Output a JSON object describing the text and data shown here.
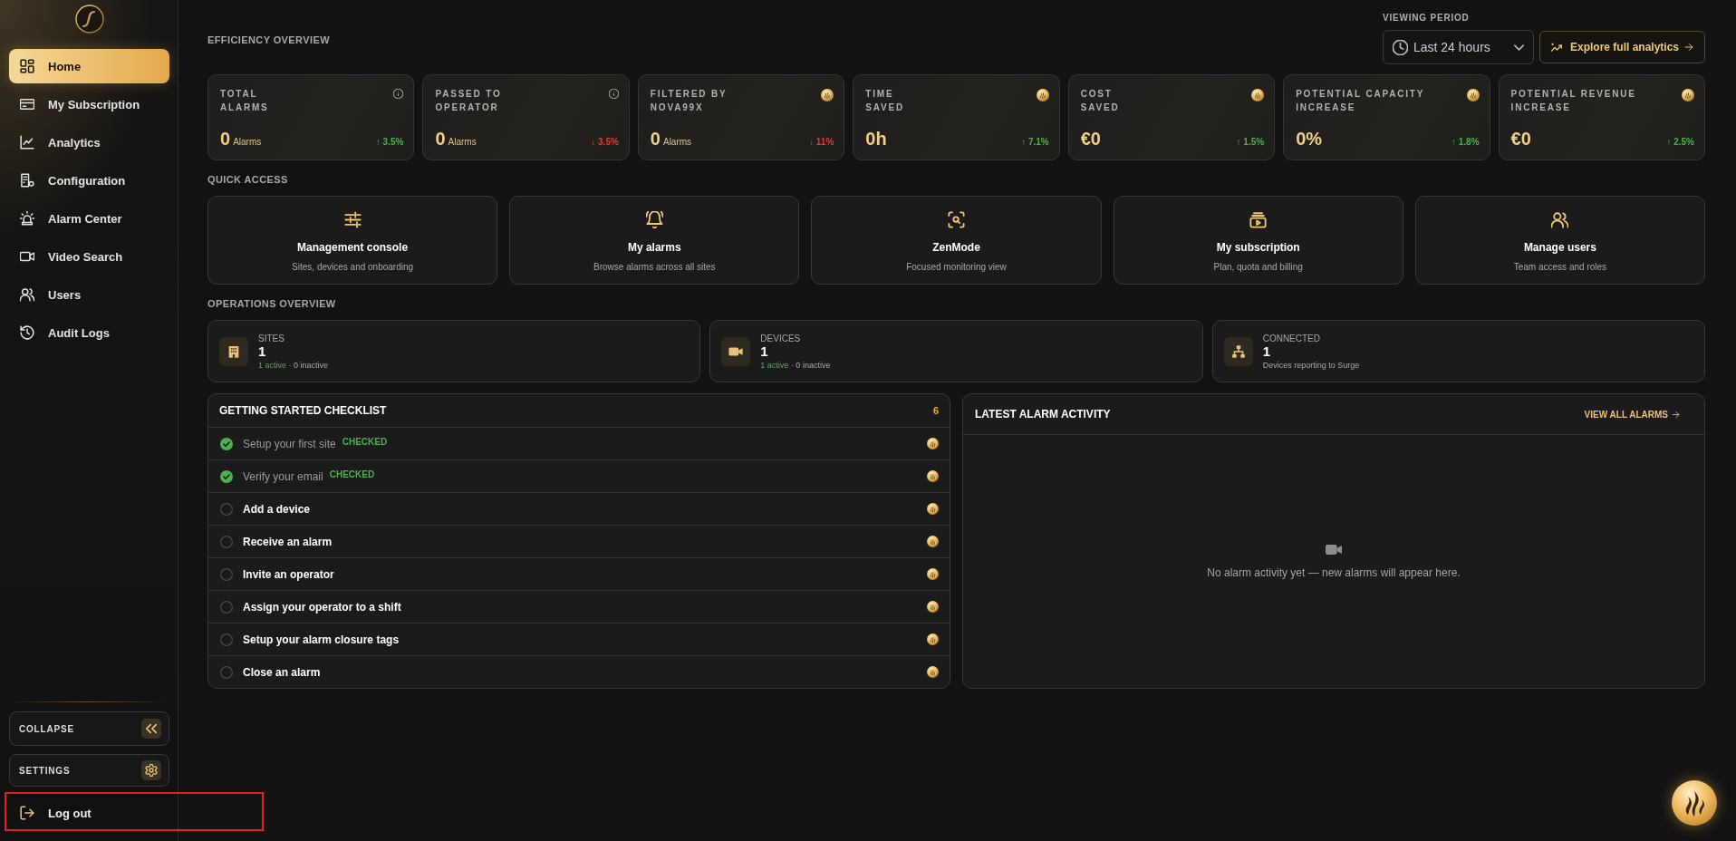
{
  "sidebar": {
    "nav": [
      {
        "label": "Home",
        "selected": true
      },
      {
        "label": "My Subscription",
        "selected": false
      },
      {
        "label": "Analytics",
        "selected": false
      },
      {
        "label": "Configuration",
        "selected": false
      },
      {
        "label": "Alarm Center",
        "selected": false
      },
      {
        "label": "Video Search",
        "selected": false
      },
      {
        "label": "Users",
        "selected": false
      },
      {
        "label": "Audit Logs",
        "selected": false
      }
    ],
    "collapse": {
      "label": "COLLAPSE"
    },
    "settings": {
      "label": "SETTINGS"
    },
    "logout": {
      "label": "Log out",
      "highlighted": true
    }
  },
  "efficiency": {
    "title": "EFFICIENCY OVERVIEW",
    "period_label": "VIEWING PERIOD",
    "period": "Last 24 hours",
    "analytics_button": "Explore full analytics",
    "kpis": [
      {
        "kind": "info",
        "label": "TOTAL\nALARMS",
        "value": "0",
        "unit": "Alarms",
        "change": {
          "text": "↑ 3.5%",
          "color": "#4cb050"
        }
      },
      {
        "kind": "info",
        "label": "PASSED TO\nOPERATOR",
        "value": "0",
        "unit": "Alarms",
        "change": {
          "text": "↓ 3.5%",
          "color": "#e53935"
        }
      },
      {
        "kind": "ai",
        "label": "FILTERED BY\nNOVA99X",
        "value": "0",
        "unit": "Alarms",
        "change": {
          "text": "↓ 11%",
          "color": "#e53935"
        }
      },
      {
        "kind": "ai",
        "label": "TIME\nSAVED",
        "value": "0h",
        "change": {
          "text": "↑ 7.1%",
          "color": "#4cb050"
        }
      },
      {
        "kind": "ai",
        "label": "COST\nSAVED",
        "value": "€0",
        "change": {
          "text": "↑ 1.5%",
          "color": "#4cb050"
        }
      },
      {
        "kind": "ai",
        "label": "POTENTIAL CAPACITY\nINCREASE",
        "value": "0%",
        "change": {
          "text": "↑ 1.8%",
          "color": "#4cb050"
        }
      },
      {
        "kind": "ai",
        "label": "POTENTIAL REVENUE\nINCREASE",
        "value": "€0",
        "change": {
          "text": "↑ 2.5%",
          "color": "#4cb050"
        }
      }
    ]
  },
  "quick_access": {
    "title": "QUICK ACCESS",
    "items": [
      {
        "title": "Management console",
        "subtitle": "Sites, devices and onboarding"
      },
      {
        "title": "My alarms",
        "subtitle": "Browse alarms across all sites"
      },
      {
        "title": "ZenMode",
        "subtitle": "Focused monitoring view"
      },
      {
        "title": "My subscription",
        "subtitle": "Plan, quota and billing"
      },
      {
        "title": "Manage users",
        "subtitle": "Team access and roles"
      }
    ]
  },
  "operations": {
    "title": "OPERATIONS OVERVIEW",
    "cards": [
      {
        "label": "SITES",
        "value": "1",
        "active": "1 active",
        "inactive": "· 0 inactive"
      },
      {
        "label": "DEVICES",
        "value": "1",
        "active": "1 active",
        "inactive": "· 0 inactive"
      },
      {
        "label": "CONNECTED",
        "value": "1",
        "note": "Devices reporting to Surge"
      }
    ]
  },
  "checklist": {
    "title": "GETTING STARTED CHECKLIST",
    "count": "6",
    "items": [
      {
        "label": "Setup your first site",
        "checked": true,
        "tag": "CHECKED"
      },
      {
        "label": "Verify your email",
        "checked": true,
        "tag": "CHECKED"
      },
      {
        "label": "Add a device",
        "checked": false
      },
      {
        "label": "Receive an alarm",
        "checked": false
      },
      {
        "label": "Invite an operator",
        "checked": false
      },
      {
        "label": "Assign your operator to a shift",
        "checked": false
      },
      {
        "label": "Setup your alarm closure tags",
        "checked": false
      },
      {
        "label": "Close an alarm",
        "checked": false
      }
    ]
  },
  "alarm_activity": {
    "title": "LATEST ALARM ACTIVITY",
    "link": "VIEW ALL ALARMS",
    "empty_message": "No alarm activity yet — new alarms will appear here."
  }
}
